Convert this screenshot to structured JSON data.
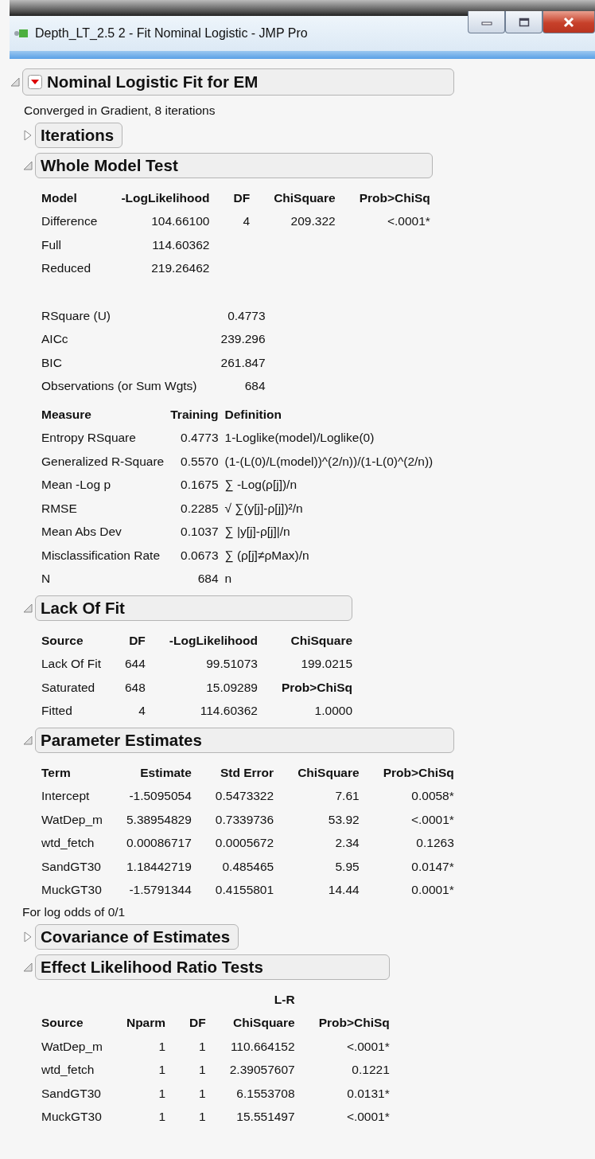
{
  "window": {
    "title": "Depth_LT_2.5 2 - Fit Nominal Logistic - JMP Pro"
  },
  "report": {
    "title": "Nominal Logistic Fit for EM",
    "expanded": true,
    "note": "Converged in Gradient, 8 iterations",
    "sections": [
      {
        "title": "Iterations",
        "expanded": false
      },
      {
        "title": "Whole Model Test",
        "expanded": true,
        "tables": [
          {
            "kind": "report",
            "columns": [
              "Model",
              "-LogLikelihood",
              "DF",
              "ChiSquare",
              "Prob>ChiSq"
            ],
            "rows": [
              [
                "Difference",
                "104.66100",
                "4",
                "209.322",
                "<.0001*"
              ],
              [
                "Full",
                "114.60362"
              ],
              [
                "Reduced",
                "219.26462"
              ]
            ]
          },
          {
            "kind": "report",
            "rows": [
              [
                "RSquare (U)",
                "0.4773"
              ],
              [
                "AICc",
                "239.296"
              ],
              [
                "BIC",
                "261.847"
              ],
              [
                "Observations (or Sum Wgts)",
                "684"
              ]
            ]
          },
          {
            "kind": "measure",
            "columns": [
              "Measure",
              "Training",
              "Definition"
            ],
            "rows": [
              [
                "Entropy RSquare",
                "0.4773",
                "1-Loglike(model)/Loglike(0)"
              ],
              [
                "Generalized R-Square",
                "0.5570",
                "(1-(L(0)/L(model))^(2/n))/(1-L(0)^(2/n))"
              ],
              [
                "Mean -Log p",
                "0.1675",
                "∑ -Log(ρ[j])/n"
              ],
              [
                "RMSE",
                "0.2285",
                "√ ∑(y[j]-ρ[j])²/n"
              ],
              [
                "Mean Abs Dev",
                "0.1037",
                "∑ |y[j]-ρ[j]|/n"
              ],
              [
                "Misclassification Rate",
                "0.0673",
                "∑ (ρ[j]≠ρMax)/n"
              ],
              [
                "N",
                "684",
                "n"
              ]
            ]
          }
        ]
      },
      {
        "title": "Lack Of Fit",
        "expanded": true,
        "tables": [
          {
            "kind": "report",
            "columns": [
              "Source",
              "DF",
              "-LogLikelihood",
              "ChiSquare"
            ],
            "rows": [
              [
                "Lack Of Fit",
                "644",
                "99.51073",
                "199.0215"
              ],
              [
                "Saturated",
                "648",
                "15.09289",
                {
                  "text": "Prob>ChiSq",
                  "bold": true
                }
              ],
              [
                "Fitted",
                "4",
                "114.60362",
                "1.0000"
              ]
            ]
          }
        ]
      },
      {
        "title": "Parameter Estimates",
        "expanded": true,
        "tables": [
          {
            "kind": "report",
            "columns": [
              "Term",
              "Estimate",
              "Std Error",
              "ChiSquare",
              "Prob>ChiSq"
            ],
            "rows": [
              [
                "Intercept",
                "-1.5095054",
                "0.5473322",
                "7.61",
                "0.0058*"
              ],
              [
                "WatDep_m",
                "5.38954829",
                "0.7339736",
                "53.92",
                "<.0001*"
              ],
              [
                "wtd_fetch",
                "0.00086717",
                "0.0005672",
                "2.34",
                "0.1263"
              ],
              [
                "SandGT30",
                "1.18442719",
                "0.485465",
                "5.95",
                "0.0147*"
              ],
              [
                "MuckGT30",
                "-1.5791344",
                "0.4155801",
                "14.44",
                "0.0001*"
              ]
            ]
          }
        ],
        "note": "For log odds of 0/1"
      },
      {
        "title": "Covariance of Estimates",
        "expanded": false
      },
      {
        "title": "Effect Likelihood Ratio Tests",
        "expanded": true,
        "tables": [
          {
            "kind": "report",
            "columns": [
              "Source",
              "Nparm",
              "DF",
              {
                "over": "L-R",
                "label": "ChiSquare"
              },
              "Prob>ChiSq"
            ],
            "rows": [
              [
                "WatDep_m",
                "1",
                "1",
                "110.664152",
                "<.0001*"
              ],
              [
                "wtd_fetch",
                "1",
                "1",
                "2.39057607",
                "0.1221"
              ],
              [
                "SandGT30",
                "1",
                "1",
                "6.1553708",
                "0.0131*"
              ],
              [
                "MuckGT30",
                "1",
                "1",
                "15.551497",
                "<.0001*"
              ]
            ]
          }
        ]
      }
    ]
  }
}
